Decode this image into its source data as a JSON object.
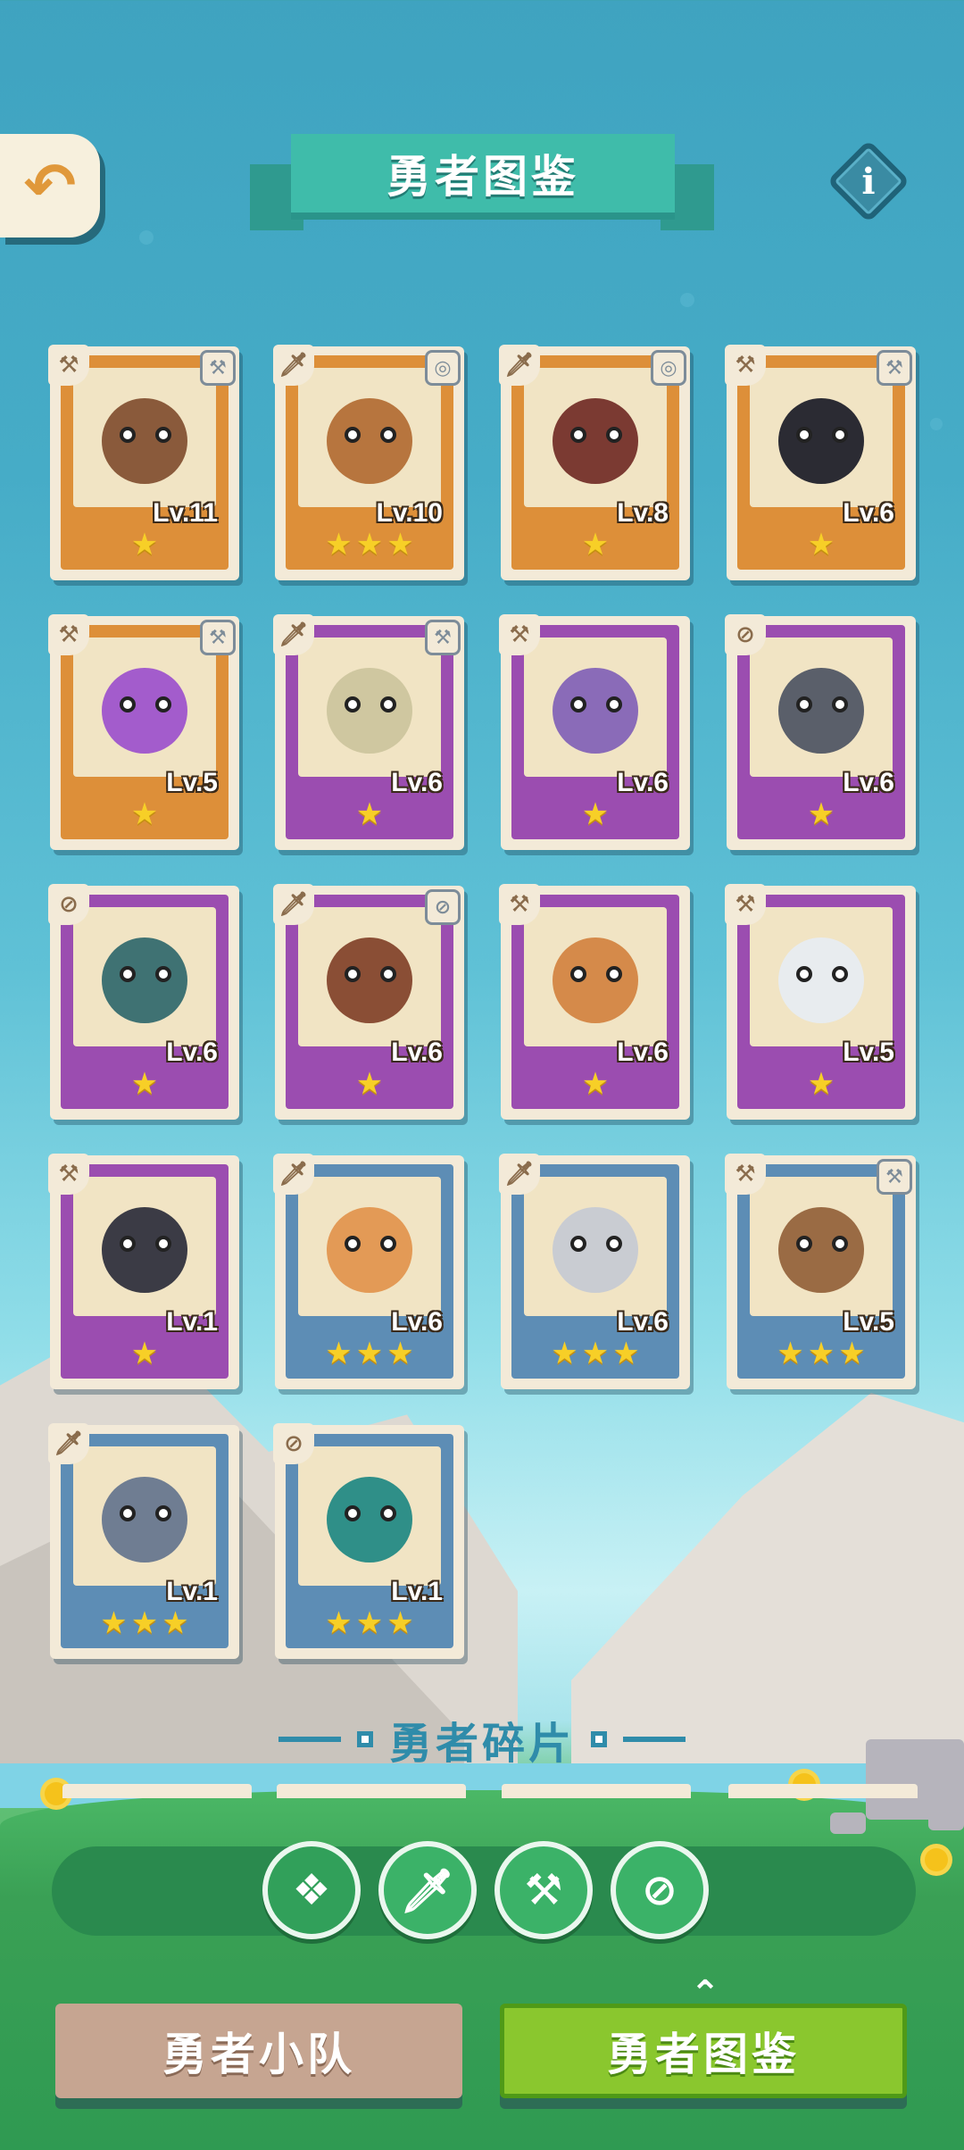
{
  "header": {
    "back_icon": "back-arrow-icon",
    "title": "勇者图鉴",
    "info_label": "i"
  },
  "cards": [
    {
      "rarity": "orange",
      "level": "Lv.11",
      "stars": 1,
      "role_icon": "hammer-icon",
      "weapon_icon": "hammer-icon",
      "face": "#8a5a3b"
    },
    {
      "rarity": "orange",
      "level": "Lv.10",
      "stars": 3,
      "role_icon": "sword-icon",
      "weapon_icon": "magic-icon",
      "face": "#b7753e"
    },
    {
      "rarity": "orange",
      "level": "Lv.8",
      "stars": 1,
      "role_icon": "sword-icon",
      "weapon_icon": "magic-icon",
      "face": "#7b3a32"
    },
    {
      "rarity": "orange",
      "level": "Lv.6",
      "stars": 1,
      "role_icon": "hammer-icon",
      "weapon_icon": "hammer-icon",
      "face": "#2b2b33"
    },
    {
      "rarity": "orange",
      "level": "Lv.5",
      "stars": 1,
      "role_icon": "hammer-icon",
      "weapon_icon": "hammer-icon",
      "face": "#a35ccc"
    },
    {
      "rarity": "purple",
      "level": "Lv.6",
      "stars": 1,
      "role_icon": "sword-icon",
      "weapon_icon": "hammer-icon",
      "face": "#cfc7a0"
    },
    {
      "rarity": "purple",
      "level": "Lv.6",
      "stars": 1,
      "role_icon": "hammer-icon",
      "weapon_icon": "",
      "face": "#8a6bb8"
    },
    {
      "rarity": "purple",
      "level": "Lv.6",
      "stars": 1,
      "role_icon": "compass-icon",
      "weapon_icon": "",
      "face": "#5a5f6a"
    },
    {
      "rarity": "purple",
      "level": "Lv.6",
      "stars": 1,
      "role_icon": "compass-icon",
      "weapon_icon": "",
      "face": "#3f7273"
    },
    {
      "rarity": "purple",
      "level": "Lv.6",
      "stars": 1,
      "role_icon": "sword-icon",
      "weapon_icon": "compass-icon",
      "face": "#8a4e35"
    },
    {
      "rarity": "purple",
      "level": "Lv.6",
      "stars": 1,
      "role_icon": "hammer-icon",
      "weapon_icon": "",
      "face": "#d58a4a"
    },
    {
      "rarity": "purple",
      "level": "Lv.5",
      "stars": 1,
      "role_icon": "hammer-icon",
      "weapon_icon": "",
      "face": "#e8ecef"
    },
    {
      "rarity": "purple",
      "level": "Lv.1",
      "stars": 1,
      "role_icon": "hammer-icon",
      "weapon_icon": "",
      "face": "#3b3b45"
    },
    {
      "rarity": "blue",
      "level": "Lv.6",
      "stars": 3,
      "role_icon": "sword-icon",
      "weapon_icon": "",
      "face": "#e39a56"
    },
    {
      "rarity": "blue",
      "level": "Lv.6",
      "stars": 3,
      "role_icon": "sword-icon",
      "weapon_icon": "",
      "face": "#c9ccd2"
    },
    {
      "rarity": "blue",
      "level": "Lv.5",
      "stars": 3,
      "role_icon": "hammer-icon",
      "weapon_icon": "hammer-icon",
      "face": "#9a6b44"
    },
    {
      "rarity": "blue",
      "level": "Lv.1",
      "stars": 3,
      "role_icon": "sword-icon",
      "weapon_icon": "",
      "face": "#6f7d92"
    },
    {
      "rarity": "blue",
      "level": "Lv.1",
      "stars": 3,
      "role_icon": "compass-icon",
      "weapon_icon": "",
      "face": "#2f8f88"
    }
  ],
  "fragments": {
    "title": "勇者碎片"
  },
  "filters": [
    {
      "name": "all-filter",
      "icon": "diamond-grid-icon",
      "glyph": "❖",
      "active": true
    },
    {
      "name": "sword-filter",
      "icon": "sword-icon",
      "glyph": "🗡",
      "active": false
    },
    {
      "name": "hammer-filter",
      "icon": "hammer-icon",
      "glyph": "⚒",
      "active": false
    },
    {
      "name": "compass-filter",
      "icon": "compass-icon",
      "glyph": "⊘",
      "active": false
    }
  ],
  "bottom_tabs": {
    "team": "勇者小队",
    "collection": "勇者图鉴",
    "active": "collection"
  },
  "colors": {
    "orange_card": "#dd8f39",
    "purple_card": "#9b4db0",
    "blue_card": "#5d8db5",
    "star": "#f7cf27",
    "accent_green": "#8ac72e"
  }
}
